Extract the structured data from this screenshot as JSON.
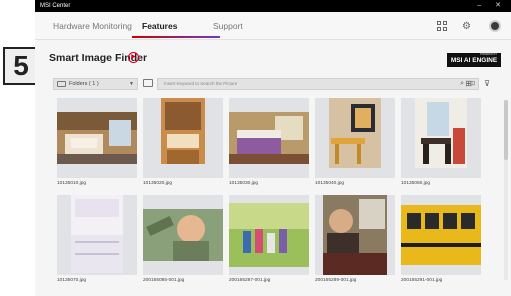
{
  "window": {
    "title": "MSI Center",
    "controls": "– ✕"
  },
  "nav": {
    "tabs": [
      {
        "label": "Hardware Monitoring"
      },
      {
        "label": "Features"
      },
      {
        "label": "Support"
      }
    ],
    "active_tab": "Features",
    "icons": [
      "grid-icon",
      "gear-icon",
      "user-avatar"
    ]
  },
  "step": {
    "number": "5"
  },
  "finder": {
    "title": "Smart Image Finder",
    "badge_top": "POWERED BY",
    "badge": "MSI AI ENGINE"
  },
  "toolbar": {
    "folders_label": "Folders ( 1 )",
    "search_placeholder": "Insert Keyword to Search the Picture"
  },
  "images": [
    {
      "file": "10135010.jpg",
      "scene": "living-room"
    },
    {
      "file": "10135020.jpg",
      "scene": "kitchen"
    },
    {
      "file": "10135030.jpg",
      "scene": "bedroom"
    },
    {
      "file": "10135040.jpg",
      "scene": "dining-room"
    },
    {
      "file": "10135060.jpg",
      "scene": "dining-room-2"
    },
    {
      "file": "10135070.jpg",
      "scene": "white-kitchen"
    },
    {
      "file": "200165085-001.jpg",
      "scene": "boy-portrait"
    },
    {
      "file": "200165287-001.jpg",
      "scene": "family-park"
    },
    {
      "file": "200165289-001.jpg",
      "scene": "girl-bus"
    },
    {
      "file": "200165291-001.jpg",
      "scene": "school-bus"
    }
  ],
  "colors": {
    "accent": "#d0021b",
    "accent2": "#6a3cc7",
    "titlebar": "#000000"
  }
}
